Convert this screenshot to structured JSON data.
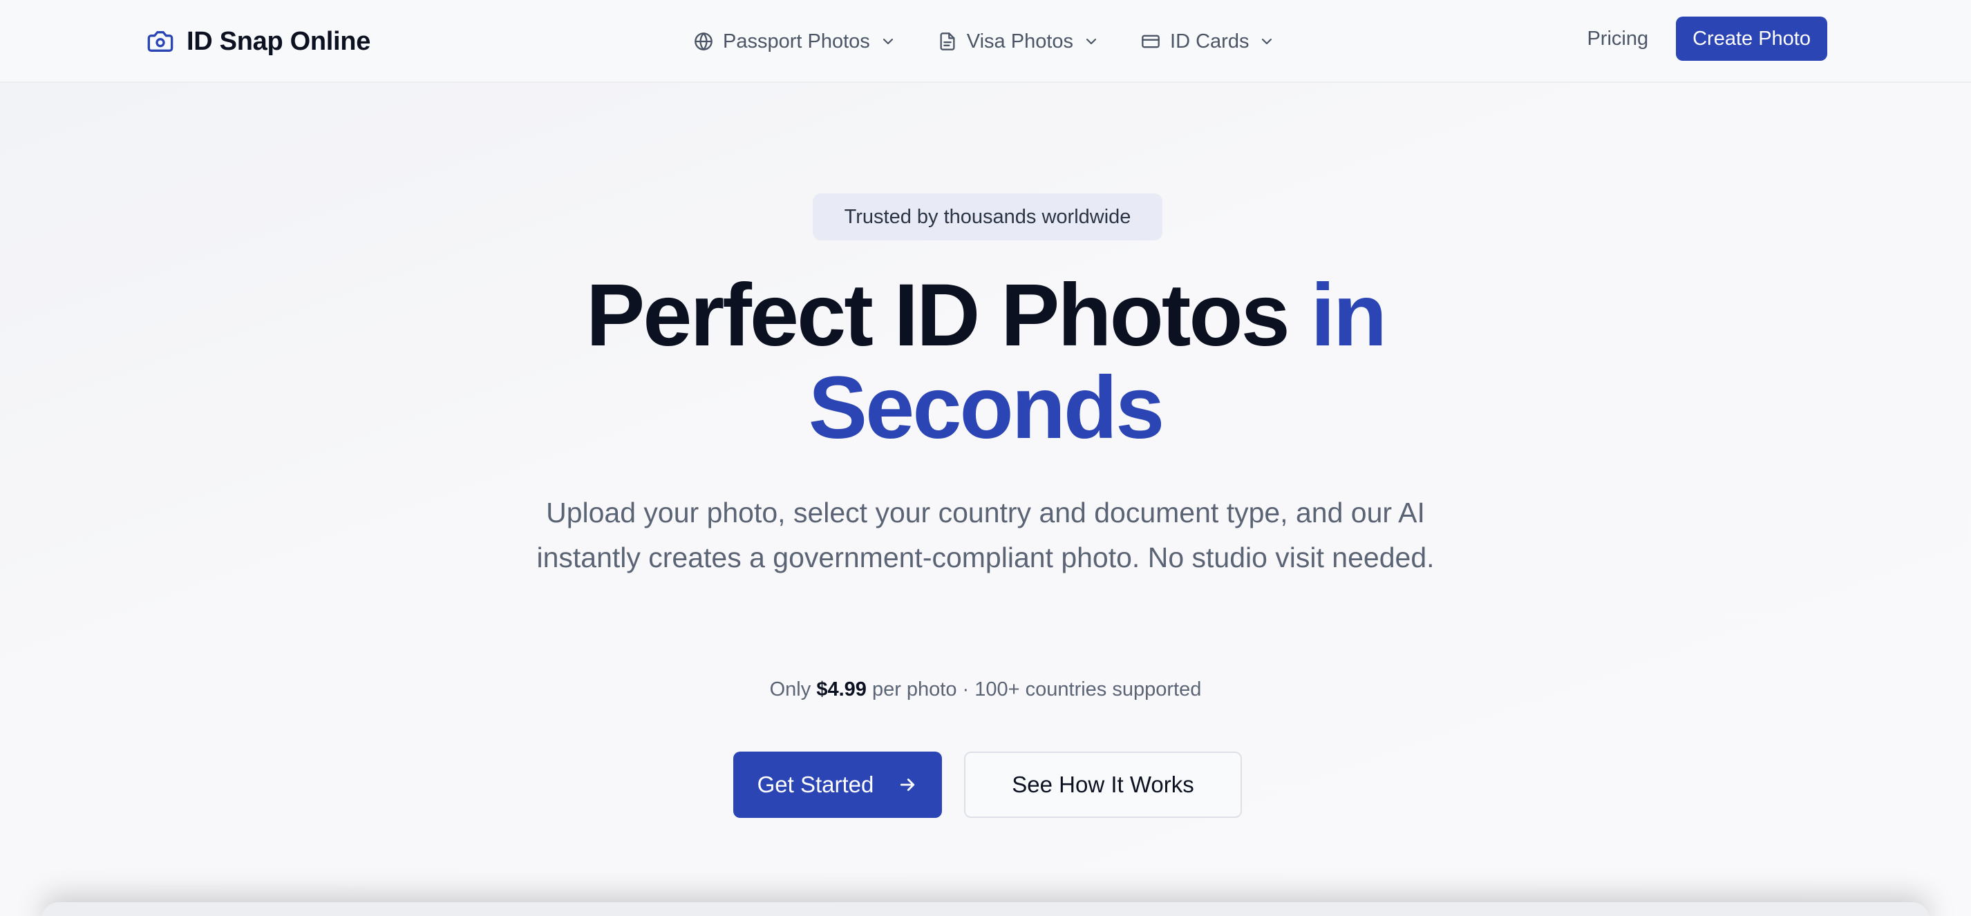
{
  "brand": {
    "name": "ID Snap Online",
    "icon": "camera-icon"
  },
  "nav": {
    "items": [
      {
        "label": "Passport Photos",
        "icon": "globe-icon"
      },
      {
        "label": "Visa Photos",
        "icon": "document-icon"
      },
      {
        "label": "ID Cards",
        "icon": "credit-card-icon"
      }
    ],
    "pricing_label": "Pricing",
    "create_label": "Create Photo"
  },
  "hero": {
    "badge": "Trusted by thousands worldwide",
    "headline_main": "Perfect ID Photos ",
    "headline_accent_1": "in",
    "headline_accent_2": "Seconds",
    "subtitle": "Upload your photo, select your country and document type, and our AI instantly creates a government-compliant photo. No studio visit needed.",
    "price_prefix": "Only ",
    "price": "$4.99",
    "price_suffix": " per photo · 100+ countries supported",
    "cta_primary": "Get Started",
    "cta_secondary": "See How It Works"
  },
  "colors": {
    "accent": "#2b45b4",
    "text_dark": "#0b1120",
    "text_muted": "#5b6475",
    "badge_bg": "#e8ebf6"
  }
}
